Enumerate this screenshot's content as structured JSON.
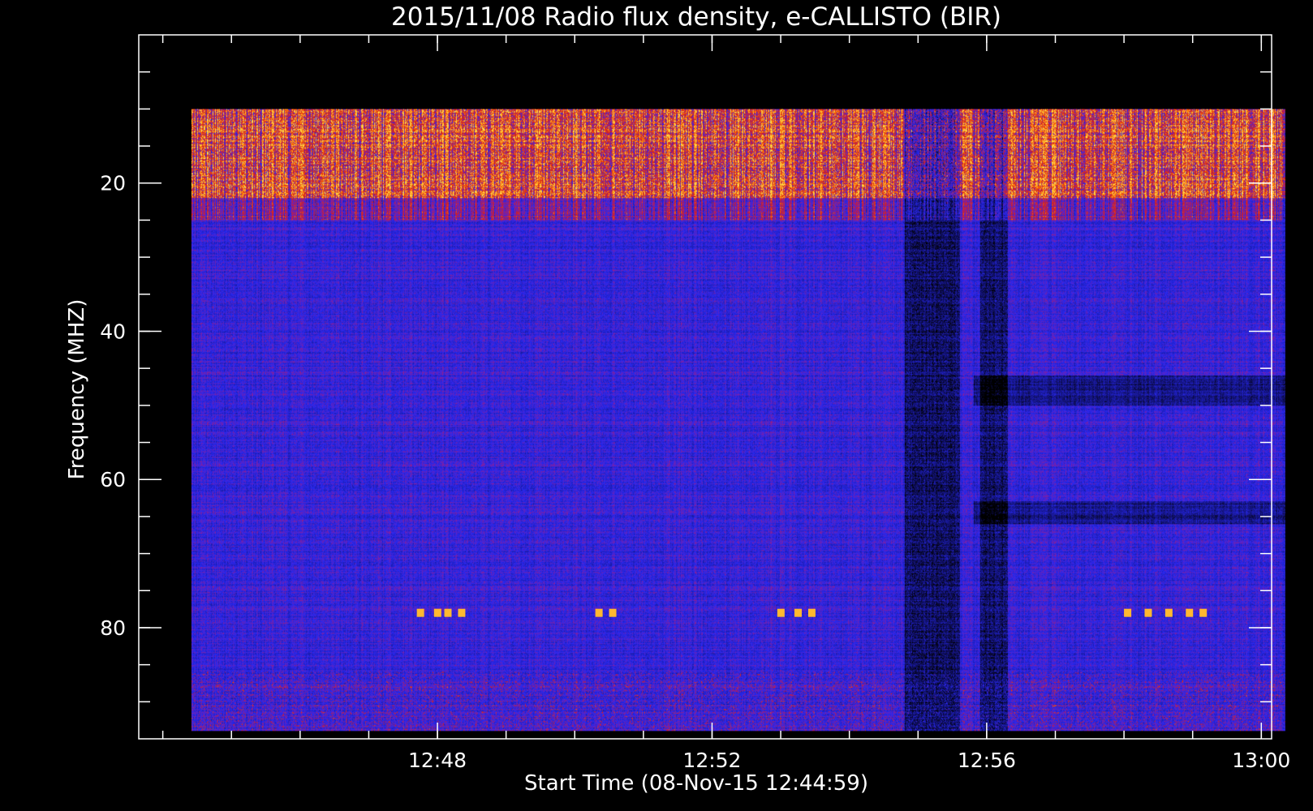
{
  "chart_data": {
    "type": "heatmap",
    "title": "2015/11/08  Radio flux density, e-CALLISTO (BIR)",
    "xlabel": "Start Time (08-Nov-15 12:44:59)",
    "ylabel": "Frequency (MHZ)",
    "x_axis": {
      "unit": "minutes since 12:44",
      "range": [
        -0.35,
        16.15
      ],
      "data_range": [
        0.417,
        16.35
      ],
      "major_ticks": [
        {
          "value": 4,
          "label": "12:48"
        },
        {
          "value": 8,
          "label": "12:52"
        },
        {
          "value": 12,
          "label": "12:56"
        },
        {
          "value": 16,
          "label": "13:00"
        }
      ],
      "minor_step": 1
    },
    "y_axis": {
      "range": [
        0,
        95
      ],
      "data_range": [
        10,
        94
      ],
      "reversed": true,
      "major_ticks": [
        {
          "value": 20,
          "label": "20"
        },
        {
          "value": 40,
          "label": "40"
        },
        {
          "value": 60,
          "label": "60"
        },
        {
          "value": 80,
          "label": "80"
        }
      ],
      "minor_step": 5
    },
    "grid": false,
    "colormap": [
      "#000000",
      "#1a1aa0",
      "#2a2af0",
      "#c02020",
      "#ff6a00",
      "#ffd040"
    ],
    "features": [
      {
        "kind": "interference-band",
        "freq_range": [
          10,
          22
        ],
        "level": "high"
      },
      {
        "kind": "interference-band",
        "freq_range": [
          22,
          25
        ],
        "level": "moderate"
      },
      {
        "kind": "dark-stripe",
        "time_range": [
          10.8,
          11.6
        ],
        "freq_range": [
          10,
          94
        ]
      },
      {
        "kind": "dark-stripe",
        "time_range": [
          11.9,
          12.3
        ],
        "freq_range": [
          10,
          94
        ]
      },
      {
        "kind": "dark-band",
        "time_range": [
          11.8,
          16.35
        ],
        "freq_range": [
          46,
          50
        ]
      },
      {
        "kind": "dark-band",
        "time_range": [
          11.8,
          16.35
        ],
        "freq_range": [
          63,
          66
        ]
      },
      {
        "kind": "bursts",
        "freq": 78,
        "times": [
          3.7,
          3.95,
          4.1,
          4.3,
          6.3,
          6.5,
          8.95,
          9.2,
          9.4,
          14.0,
          14.3,
          14.6,
          14.9,
          15.1
        ]
      }
    ]
  }
}
